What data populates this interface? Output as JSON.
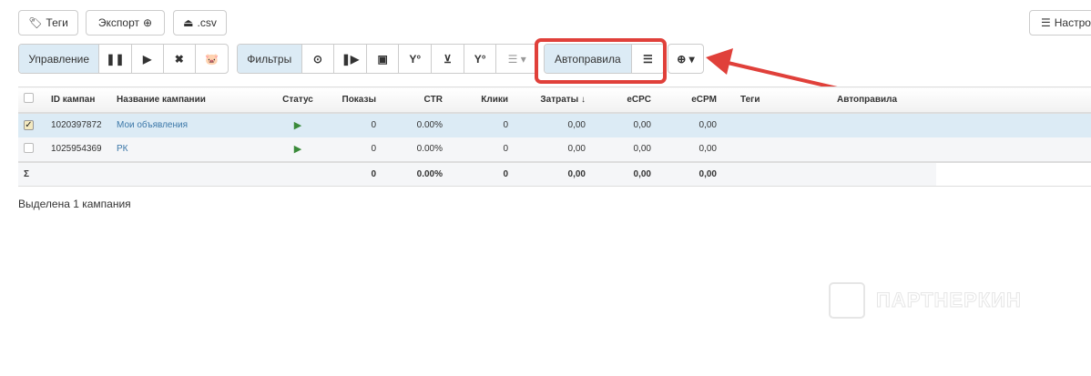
{
  "top": {
    "tags": "Теги",
    "export": "Экспорт",
    "csv": ".csv",
    "settings": "Настро"
  },
  "toolbar": {
    "manage": "Управление",
    "filters": "Фильтры",
    "autorules": "Автоправила"
  },
  "table": {
    "headers": [
      "ID кампан",
      "Название кампании",
      "Статус",
      "Показы",
      "CTR",
      "Клики",
      "Затраты ↓",
      "eCPC",
      "eCPM",
      "Теги",
      "Автоправила"
    ],
    "rows": [
      {
        "checked": true,
        "id": "1020397872",
        "name": "Мои объявления",
        "impr": "0",
        "ctr": "0.00%",
        "clicks": "0",
        "cost": "0,00",
        "ecpc": "0,00",
        "ecpm": "0,00"
      },
      {
        "checked": false,
        "id": "1025954369",
        "name": "РК",
        "impr": "0",
        "ctr": "0.00%",
        "clicks": "0",
        "cost": "0,00",
        "ecpc": "0,00",
        "ecpm": "0,00"
      }
    ],
    "sum": {
      "label": "Σ",
      "impr": "0",
      "ctr": "0.00%",
      "clicks": "0",
      "cost": "0,00",
      "ecpc": "0,00",
      "ecpm": "0,00"
    }
  },
  "status": "Выделена 1 кампания",
  "watermark": "ПАРТНЕРКИН",
  "colors": {
    "highlight": "#e0403a",
    "selected": "#dcebf5"
  }
}
